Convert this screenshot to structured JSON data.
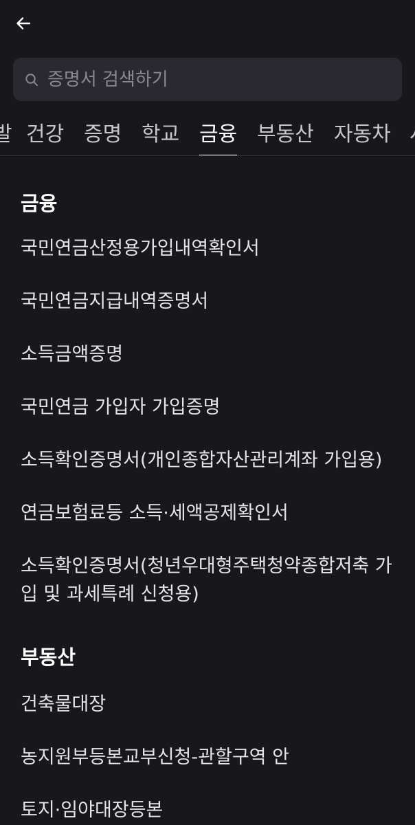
{
  "header": {
    "back_icon": "arrow-left-icon"
  },
  "search": {
    "placeholder": "증명서 검색하기",
    "value": "",
    "icon": "search-icon"
  },
  "tabs": [
    {
      "label": "발",
      "active": false
    },
    {
      "label": "건강",
      "active": false
    },
    {
      "label": "증명",
      "active": false
    },
    {
      "label": "학교",
      "active": false
    },
    {
      "label": "금융",
      "active": true
    },
    {
      "label": "부동산",
      "active": false
    },
    {
      "label": "자동차",
      "active": false
    },
    {
      "label": "사",
      "active": false
    }
  ],
  "sections": [
    {
      "title": "금융",
      "items": [
        "국민연금산정용가입내역확인서",
        "국민연금지급내역증명서",
        "소득금액증명",
        "국민연금 가입자 가입증명",
        "소득확인증명서(개인종합자산관리계좌 가입용)",
        "연금보험료등 소득·세액공제확인서",
        "소득확인증명서(청년우대형주택청약종합저축 가입 및 과세특례 신청용)"
      ]
    },
    {
      "title": "부동산",
      "items": [
        "건축물대장",
        "농지원부등본교부신청-관할구역 안",
        "토지·임야대장등본"
      ]
    }
  ],
  "colors": {
    "background": "#18171c",
    "search_bg": "#2a292f",
    "text": "#e4e3e9",
    "muted": "#8a8991"
  }
}
